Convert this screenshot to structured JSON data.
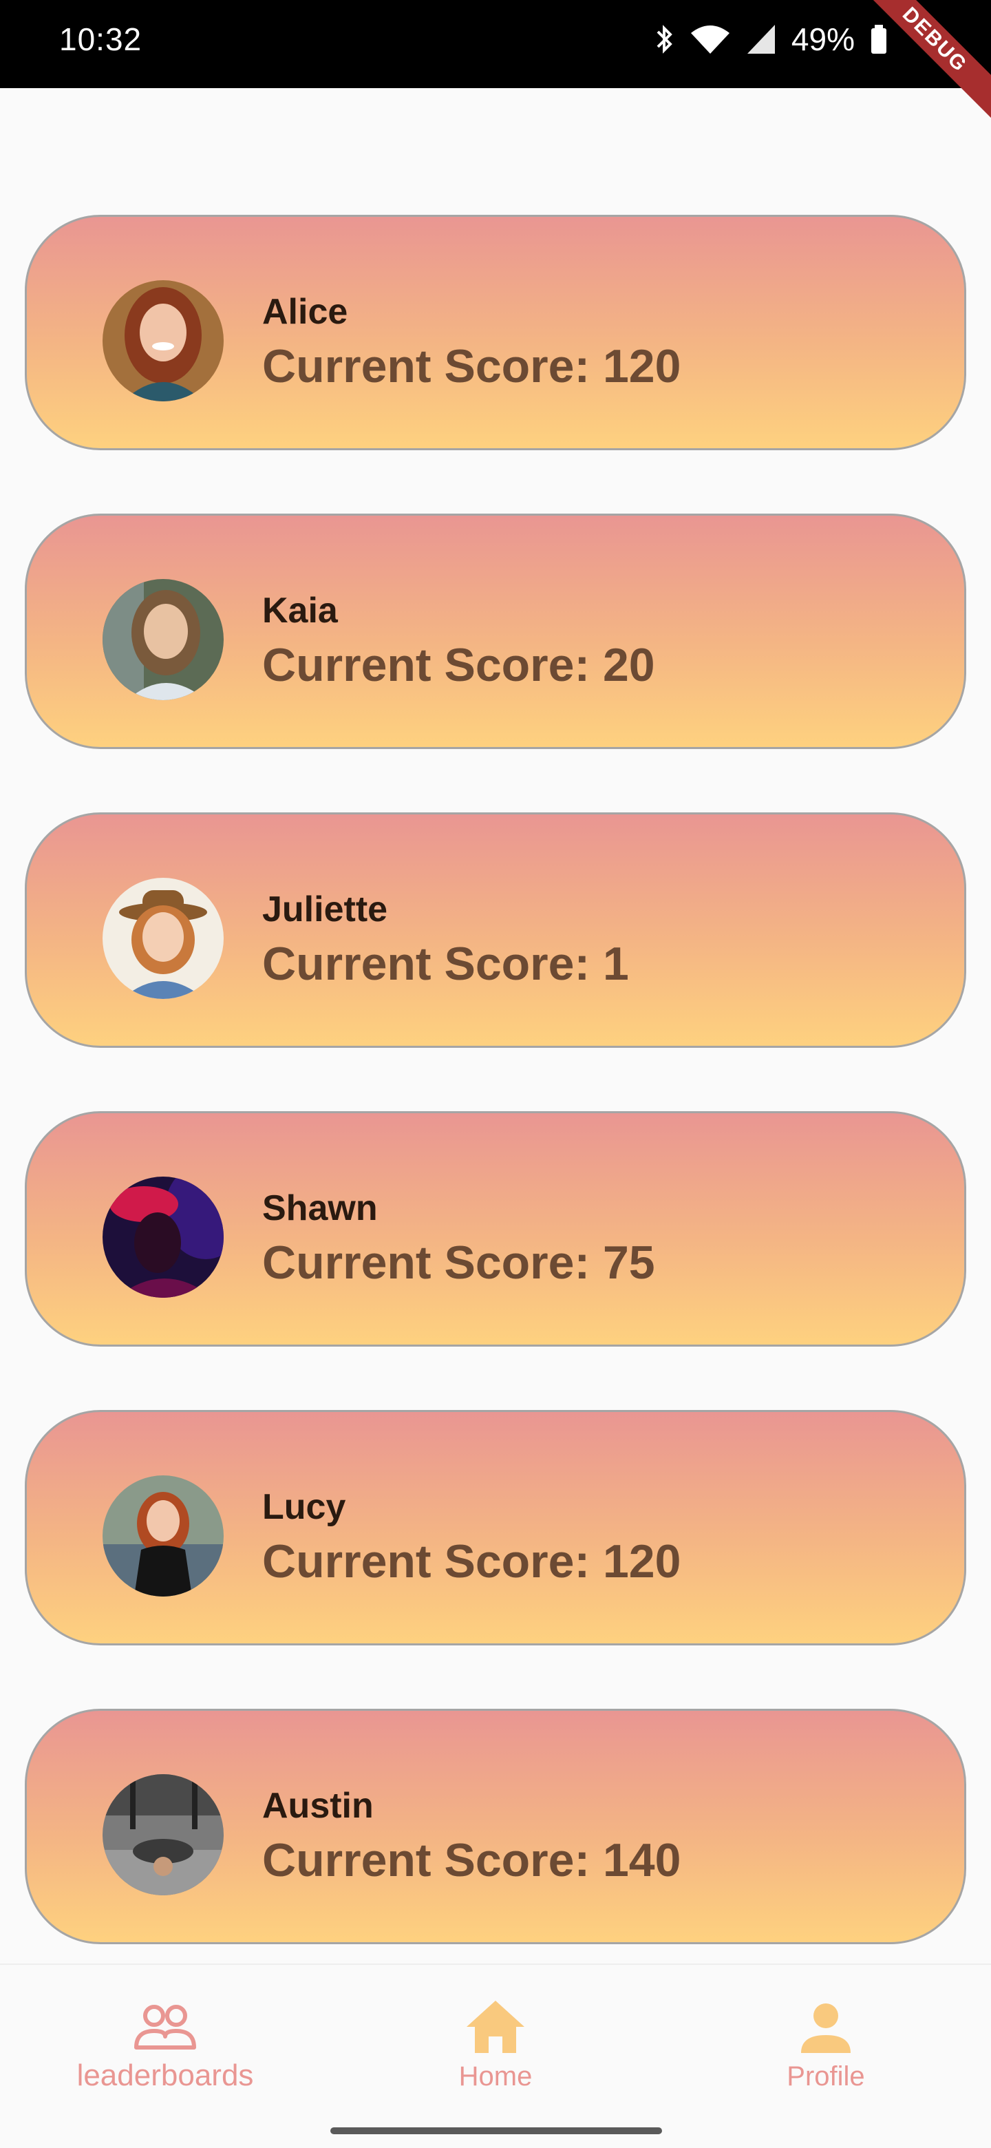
{
  "status_bar": {
    "time": "10:32",
    "battery": "49%",
    "debug_banner": "DEBUG",
    "icons": [
      "bluetooth-icon",
      "wifi-icon",
      "signal-icon",
      "battery-icon"
    ]
  },
  "players": [
    {
      "name": "Alice",
      "score_text": "Current Score: 120",
      "score": 120,
      "avatar": "avatar-alice"
    },
    {
      "name": "Kaia",
      "score_text": "Current Score: 20",
      "score": 20,
      "avatar": "avatar-kaia"
    },
    {
      "name": "Juliette",
      "score_text": "Current Score: 1",
      "score": 1,
      "avatar": "avatar-juliette"
    },
    {
      "name": "Shawn",
      "score_text": "Current Score: 75",
      "score": 75,
      "avatar": "avatar-shawn"
    },
    {
      "name": "Lucy",
      "score_text": "Current Score: 120",
      "score": 120,
      "avatar": "avatar-lucy"
    },
    {
      "name": "Austin",
      "score_text": "Current Score: 140",
      "score": 140,
      "avatar": "avatar-austin"
    }
  ],
  "bottom_nav": {
    "items": [
      {
        "label": "leaderboards",
        "icon": "people-icon",
        "color": "#e99692"
      },
      {
        "label": "Home",
        "icon": "home-icon",
        "color": "#f9c97e"
      },
      {
        "label": "Profile",
        "icon": "person-icon",
        "color": "#f9c97e"
      }
    ],
    "label_colors": [
      "#e99692",
      "#e99692",
      "#e99692"
    ]
  },
  "colors": {
    "card_top": "#e99692",
    "card_bottom": "#fed17f",
    "name_text": "#2a1a10",
    "score_text": "#6c4a33"
  }
}
